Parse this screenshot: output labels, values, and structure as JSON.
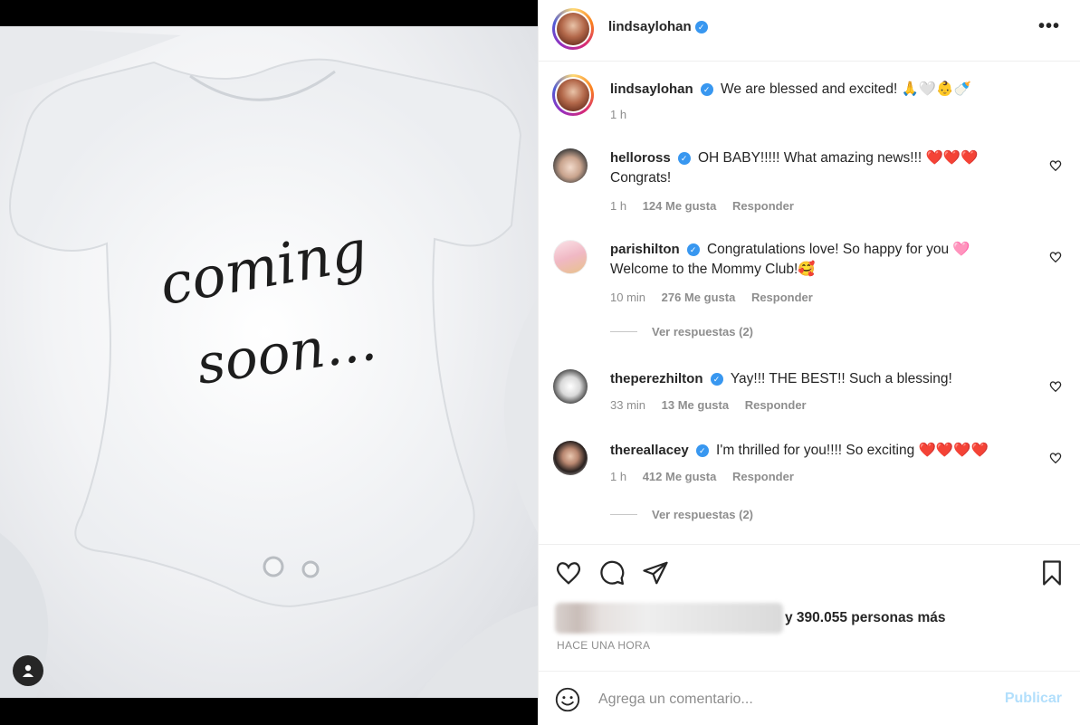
{
  "post": {
    "owner": "lindsaylohan",
    "more_label": "•••",
    "caption": {
      "username": "lindsaylohan",
      "text": "We are blessed and excited! 🙏🤍👶🍼",
      "time": "1 h"
    },
    "image": {
      "handwriting_line1": "coming",
      "handwriting_line2": "soon..."
    }
  },
  "comments": [
    {
      "username": "helloross",
      "text": "OH BABY!!!!! What amazing news!!! ❤️❤️❤️",
      "text2": "Congrats!",
      "time": "1 h",
      "likes": "124 Me gusta",
      "reply": "Responder"
    },
    {
      "username": "parishilton",
      "text": "Congratulations love! So happy for you 🩷",
      "text2": "Welcome to the Mommy Club!🥰",
      "time": "10 min",
      "likes": "276 Me gusta",
      "reply": "Responder",
      "view_replies": "Ver respuestas (2)"
    },
    {
      "username": "theperezhilton",
      "text": "Yay!!! THE BEST!! Such a blessing!",
      "time": "33 min",
      "likes": "13 Me gusta",
      "reply": "Responder"
    },
    {
      "username": "thereallacey",
      "text": "I'm thrilled for you!!!! So exciting ❤️❤️❤️❤️",
      "time": "1 h",
      "likes": "412 Me gusta",
      "reply": "Responder",
      "view_replies": "Ver respuestas (2)"
    }
  ],
  "actions": {
    "likes_suffix": "y 390.055 personas más",
    "timestamp": "HACE UNA HORA"
  },
  "comment_box": {
    "placeholder": "Agrega un comentario...",
    "publish_label": "Publicar"
  },
  "colors": {
    "verified": "#3897f0",
    "publish_disabled": "#b2dffc",
    "heart_red": "#ed1c24",
    "muted": "#8e8e8e"
  },
  "icons": [
    "user-tag-icon",
    "verified-icon",
    "more-options-icon",
    "heart-icon",
    "comment-icon",
    "share-icon",
    "bookmark-icon",
    "emoji-icon"
  ]
}
